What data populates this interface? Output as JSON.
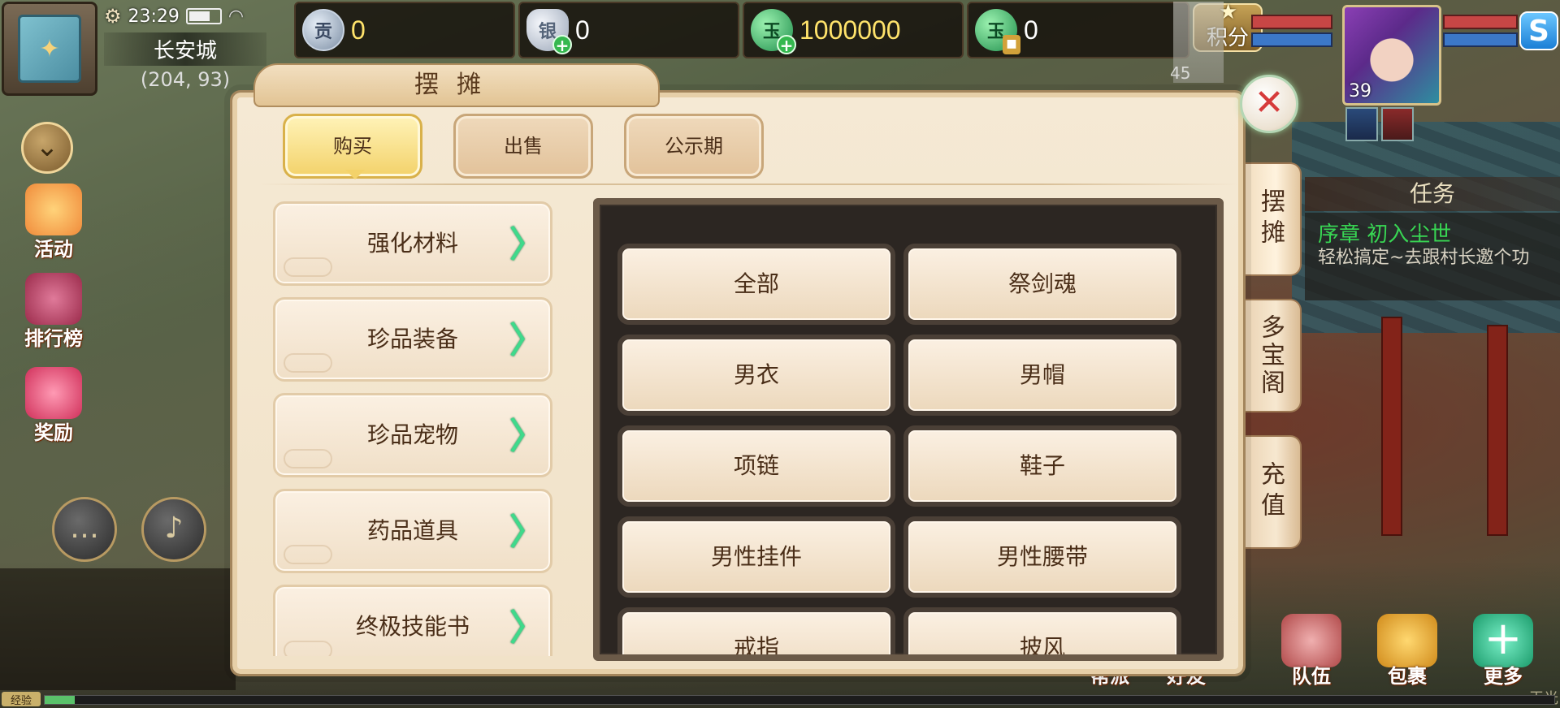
{
  "status": {
    "time": "23:29"
  },
  "location": {
    "name": "长安城",
    "coords": "(204, 93)"
  },
  "currency": [
    {
      "id": "gong",
      "icon": "contribution-coin-icon",
      "glyph": "贡",
      "value": "0"
    },
    {
      "id": "silver",
      "icon": "silver-ingot-icon",
      "glyph": "银",
      "value": "0"
    },
    {
      "id": "jade",
      "icon": "jade-coin-icon",
      "glyph": "玉",
      "value": "1000000"
    },
    {
      "id": "jade_locked",
      "icon": "locked-jade-coin-icon",
      "glyph": "玉",
      "value": "0"
    }
  ],
  "points_label": "积分",
  "pet_level": "45",
  "hero_level": "39",
  "quest": {
    "header": "任务",
    "title": "序章 初入尘世",
    "desc": "轻松搞定~去跟村长邀个功"
  },
  "side_tabs": [
    "摆摊",
    "多宝阁",
    "充值"
  ],
  "left_buttons": [
    {
      "label": "活动",
      "icon": "horn-icon",
      "color": "#f3a73c"
    },
    {
      "label": "排行榜",
      "icon": "ranking-icon",
      "color": "#c64a6a"
    },
    {
      "label": "奖励",
      "icon": "gift-icon",
      "color": "#e8506a"
    }
  ],
  "exp_label": "经验",
  "bottom_menu": [
    {
      "label": "帮派",
      "icon": "faction-icon",
      "color": "#8a6a4a"
    },
    {
      "label": "好友",
      "icon": "friends-icon",
      "color": "#8a6a4a"
    },
    {
      "label": "队伍",
      "icon": "team-icon",
      "color": "#c86a6a"
    },
    {
      "label": "包裹",
      "icon": "bag-icon",
      "color": "#e0a83a"
    },
    {
      "label": "更多",
      "icon": "plus-icon",
      "color": "#2fb08a"
    }
  ],
  "watermark": "玉光",
  "stall": {
    "title": "摆摊",
    "tabs": [
      {
        "label": "购买",
        "active": true
      },
      {
        "label": "出售",
        "active": false
      },
      {
        "label": "公示期",
        "active": false
      }
    ],
    "categories": [
      "强化材料",
      "珍品装备",
      "珍品宠物",
      "药品道具",
      "终极技能书"
    ],
    "items": [
      "全部",
      "祭剑魂",
      "男衣",
      "男帽",
      "项链",
      "鞋子",
      "男性挂件",
      "男性腰带",
      "戒指",
      "披风"
    ]
  },
  "colors": {
    "panel_bg": "#f5e9d4",
    "accent_green": "#3fd98b",
    "close_red": "#d63b3b"
  }
}
